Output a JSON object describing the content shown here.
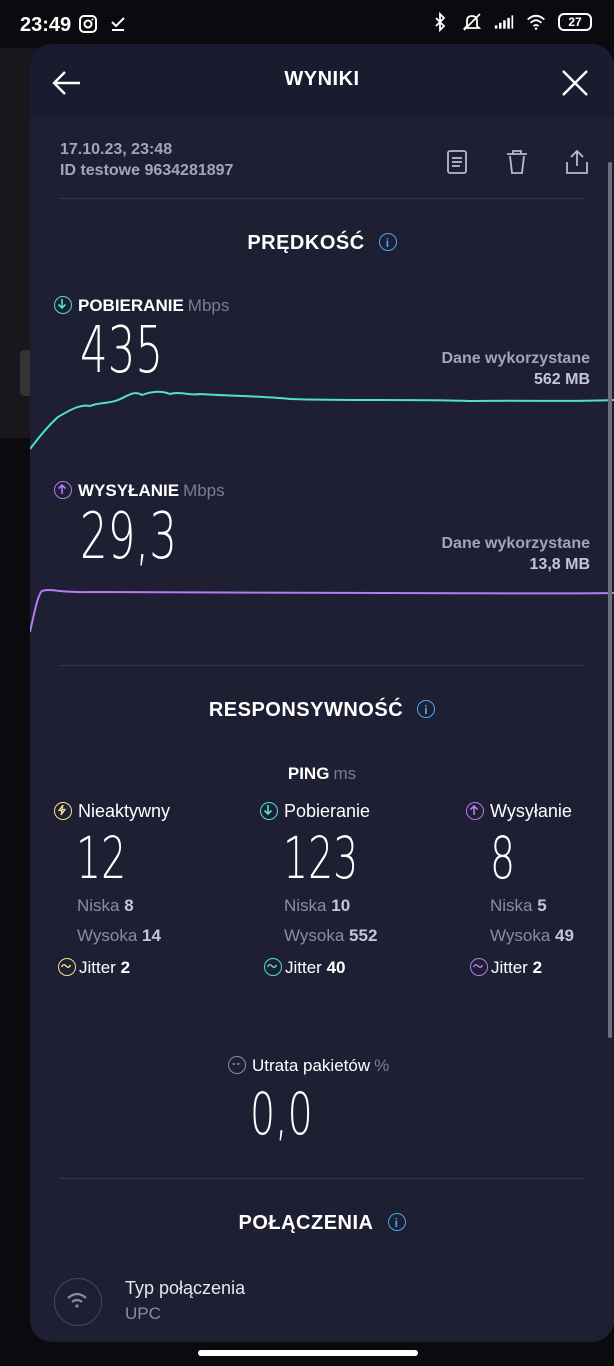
{
  "status_bar": {
    "time": "23:49",
    "battery": "27"
  },
  "header": {
    "title": "WYNIKI"
  },
  "meta": {
    "date": "17.10.23, 23:48",
    "id": "ID testowe 9634281897"
  },
  "speed": {
    "title": "PRĘDKOŚĆ",
    "download": {
      "label": "POBIERANIE",
      "unit": "Mbps",
      "value": "435",
      "usage_title": "Dane wykorzystane",
      "usage_value": "562 MB",
      "color": "#4fe0d2"
    },
    "upload": {
      "label": "WYSYŁANIE",
      "unit": "Mbps",
      "value": "29,3",
      "usage_title": "Dane wykorzystane",
      "usage_value": "13,8 MB",
      "color": "#b57bf0"
    }
  },
  "responsiveness": {
    "title": "RESPONSYWNOŚĆ",
    "ping_label": "PING",
    "ping_unit": "ms",
    "columns": [
      {
        "label": "Nieaktywny",
        "value": "12",
        "low_label": "Niska",
        "low": "8",
        "high_label": "Wysoka",
        "high": "14",
        "jitter_label": "Jitter",
        "jitter": "2",
        "color": "#f5e08a"
      },
      {
        "label": "Pobieranie",
        "value": "123",
        "low_label": "Niska",
        "low": "10",
        "high_label": "Wysoka",
        "high": "552",
        "jitter_label": "Jitter",
        "jitter": "40",
        "color": "#4fe0d2"
      },
      {
        "label": "Wysyłanie",
        "value": "8",
        "low_label": "Niska",
        "low": "5",
        "high_label": "Wysoka",
        "high": "49",
        "jitter_label": "Jitter",
        "jitter": "2",
        "color": "#b57bf0"
      }
    ],
    "packet_loss": {
      "label": "Utrata pakietów",
      "unit": "%",
      "value": "0,0"
    }
  },
  "connections": {
    "title": "POŁĄCZENIA",
    "type_label": "Typ połączenia",
    "type_value": "UPC"
  }
}
